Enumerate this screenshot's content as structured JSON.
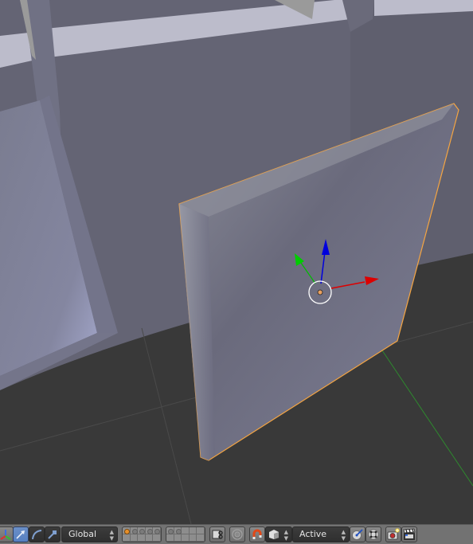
{
  "app": "Blender 3D View",
  "viewport": {
    "description": "3D viewport in solid shading mode with selected plane object",
    "selected_object_outline_color": "#f5a542",
    "background_floor_color": "#393939",
    "wall_color": "#646474",
    "gizmo": {
      "x_axis_color": "#dd0000",
      "y_axis_color": "#00cc00",
      "z_axis_color": "#0000dd",
      "origin_color": "#e8a060"
    }
  },
  "toolbar": {
    "manipulator_icon": "axis-manipulator-icon",
    "translate_icon": "translate-arrow-icon",
    "rotate_icon": "rotate-arc-icon",
    "scale_icon": "scale-icon",
    "orientation": {
      "selected": "Global"
    },
    "layers_group1": {
      "active_index": 0,
      "occupied": [
        0,
        1,
        2,
        3,
        4
      ]
    },
    "layers_group2": {
      "occupied": [
        0,
        1
      ]
    },
    "lock_camera_icon": "lock-layers-icon",
    "proportional_edit_icon": "proportional-edit-icon",
    "snap_icon": "magnet-icon",
    "snap_element_icon": "cube-icon",
    "snap_target": {
      "selected": "Active"
    },
    "align_rotation_icon": "align-rotation-icon",
    "project_snap_icon": "snap-project-icon",
    "render_icon": "opengl-render-icon",
    "render_animation_icon": "clapperboard-icon"
  }
}
